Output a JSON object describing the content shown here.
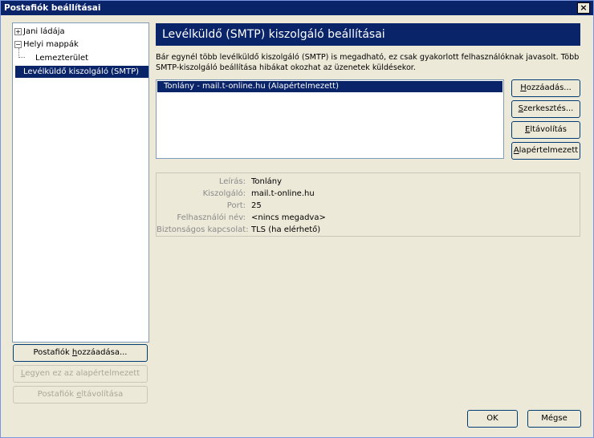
{
  "window": {
    "title": "Postafiók beállításai",
    "close_glyph": "×"
  },
  "tree": {
    "items": [
      {
        "label": "Jani ládája",
        "expander": "+"
      },
      {
        "label": "Helyi mappák",
        "expander": "−"
      },
      {
        "label": "Lemezterület"
      },
      {
        "label": "Levélküldő kiszolgáló (SMTP)"
      }
    ]
  },
  "left_buttons": {
    "add_prefix": "Postafiók ",
    "add_key": "h",
    "add_suffix": "ozzáadása...",
    "default_key": "L",
    "default_suffix": "egyen ez az alapértelmezett",
    "remove_prefix": "Postafiók ",
    "remove_key": "e",
    "remove_suffix": "ltávolítása"
  },
  "header": {
    "title": "Levélküldő (SMTP) kiszolgáló beállításai"
  },
  "description": {
    "line1": "Bár egynél több levélküldő kiszolgáló (SMTP) is megadható, ez csak gyakorlott felhasználóknak javasolt. Több",
    "line2": "SMTP-kiszolgáló beállítása hibákat okozhat az üzenetek küldésekor."
  },
  "server_list": {
    "items": [
      "Tonlány - mail.t-online.hu  (Alapértelmezett)"
    ]
  },
  "right_buttons": {
    "add_key": "H",
    "add_rest": "ozzáadás...",
    "edit_key": "S",
    "edit_rest": "zerkesztés...",
    "remove_key": "E",
    "remove_rest": "ltávolítás",
    "default_key": "A",
    "default_rest": "lapértelmezett"
  },
  "details": {
    "description_label": "Leírás:",
    "description_value": "Tonlány",
    "server_label": "Kiszolgáló:",
    "server_value": "mail.t-online.hu",
    "port_label": "Port:",
    "port_value": "25",
    "username_label": "Felhasználói név:",
    "username_value": "<nincs megadva>",
    "security_label": "Biztonságos kapcsolat:",
    "security_value": "TLS (ha elérhető)"
  },
  "footer": {
    "ok_label": "OK",
    "cancel_label": "Mégse"
  }
}
